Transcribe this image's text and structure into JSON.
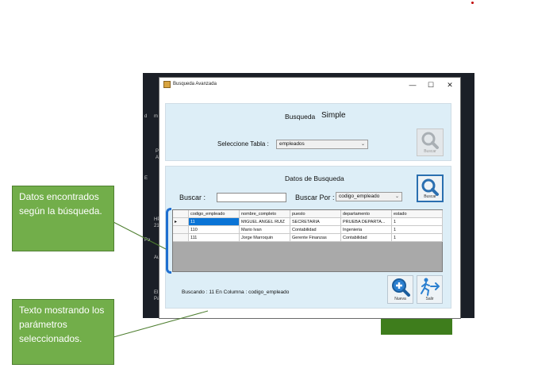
{
  "window": {
    "title": "Busqueda Avanzada",
    "minimize": "—",
    "maximize": "☐",
    "close": "✕"
  },
  "top_panel": {
    "heading": "Busqueda",
    "heading_mode": "Simple",
    "table_label": "Seleccione Tabla :",
    "table_value": "empleados",
    "search_button_caption": "Buscar"
  },
  "search_panel": {
    "heading": "Datos de Busqueda",
    "search_label": "Buscar :",
    "search_value": "",
    "search_by_label": "Buscar Por :",
    "search_by_value": "codigo_empleado",
    "search_button_caption": "Buscar"
  },
  "grid": {
    "columns": [
      "codigo_empleado",
      "nombre_completo",
      "puesto",
      "departamento",
      "estado"
    ],
    "rows": [
      [
        "11",
        "MIGUEL ANGEL RUIZ",
        "SECRETARIA",
        "PRUEBA DEPARTA...",
        "1"
      ],
      [
        "110",
        "Mario Ivan",
        "Contabilidad",
        "Ingenieria",
        "1"
      ],
      [
        "111",
        "Jorge Marroquin",
        "Gerente Finanzas",
        "Contabilidad",
        "1"
      ]
    ],
    "current_row_marker": "▸"
  },
  "status_text": "Buscando : 11 En Columna : codigo_empleado",
  "buttons": {
    "new_label": "Nueva",
    "exit_label": "Salir"
  },
  "annotations": {
    "found_data": "Datos encontrados según la búsqueda.",
    "params_text": "Texto mostrando los parámetros seleccionados."
  },
  "desktop_fragments": [
    "d",
    "m",
    "Pr",
    "A",
    "E",
    "HP",
    "21",
    "Pa",
    "Au",
    "El",
    "Pa"
  ],
  "colors": {
    "annotation_green": "#72ae4a",
    "bracket_blue": "#1f6fd0",
    "selection_blue": "#0a74d6",
    "panel_blue": "#ddeef7"
  }
}
